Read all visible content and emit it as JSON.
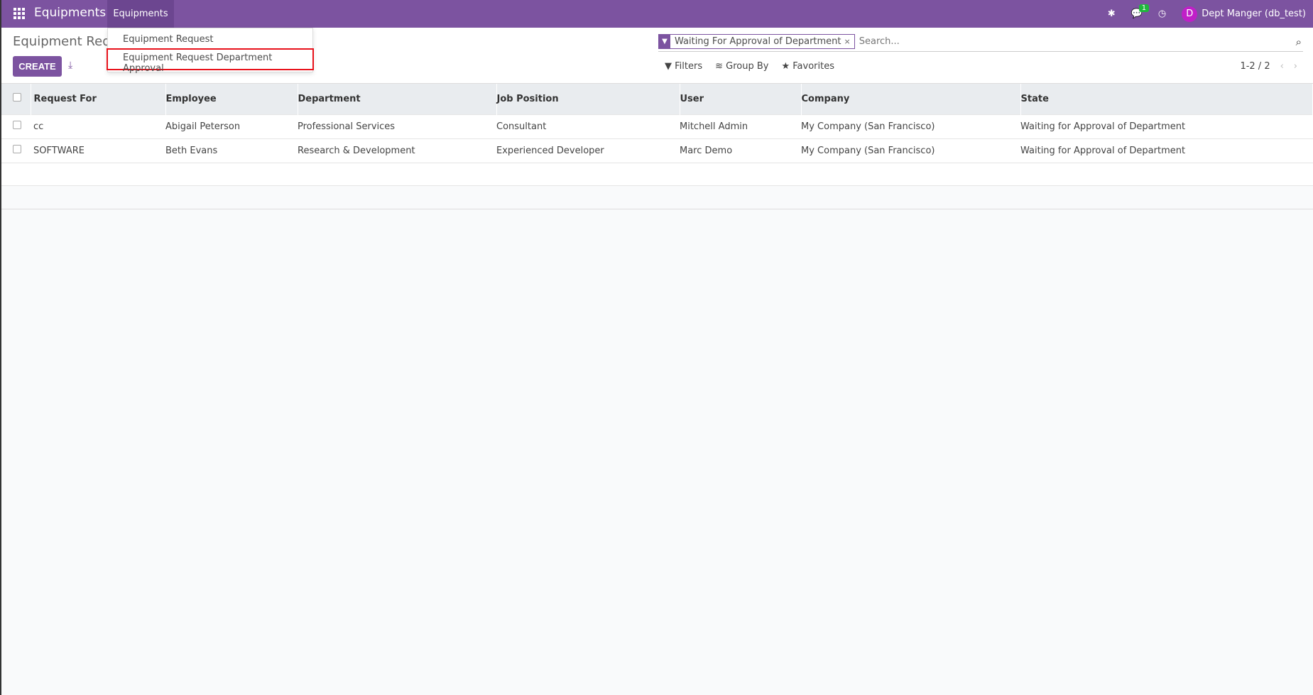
{
  "topbar": {
    "app_title": "Equipments",
    "menu": "Equipments",
    "user": "Dept Manger (db_test)",
    "avatar_letter": "D",
    "messages_count": "1"
  },
  "dropdown": {
    "items": [
      "Equipment Request",
      "Equipment Request Department Approval"
    ]
  },
  "control": {
    "title": "Equipment Requ",
    "create_label": "CREATE",
    "facet": "Waiting For Approval of Department",
    "facet_remove": "×",
    "search_placeholder": "Search...",
    "filters": "Filters",
    "group_by": "Group By",
    "favorites": "Favorites",
    "pager": "1-2 / 2"
  },
  "table": {
    "columns": [
      "Request For",
      "Employee",
      "Department",
      "Job Position",
      "User",
      "Company",
      "State"
    ],
    "rows": [
      [
        "cc",
        "Abigail Peterson",
        "Professional Services",
        "Consultant",
        "Mitchell Admin",
        "My Company (San Francisco)",
        "Waiting for Approval of Department"
      ],
      [
        "SOFTWARE",
        "Beth Evans",
        "Research & Development",
        "Experienced Developer",
        "Marc Demo",
        "My Company (San Francisco)",
        "Waiting for Approval of Department"
      ]
    ]
  },
  "colors": {
    "brand": "#7c53a0",
    "highlight": "#e8121b"
  }
}
